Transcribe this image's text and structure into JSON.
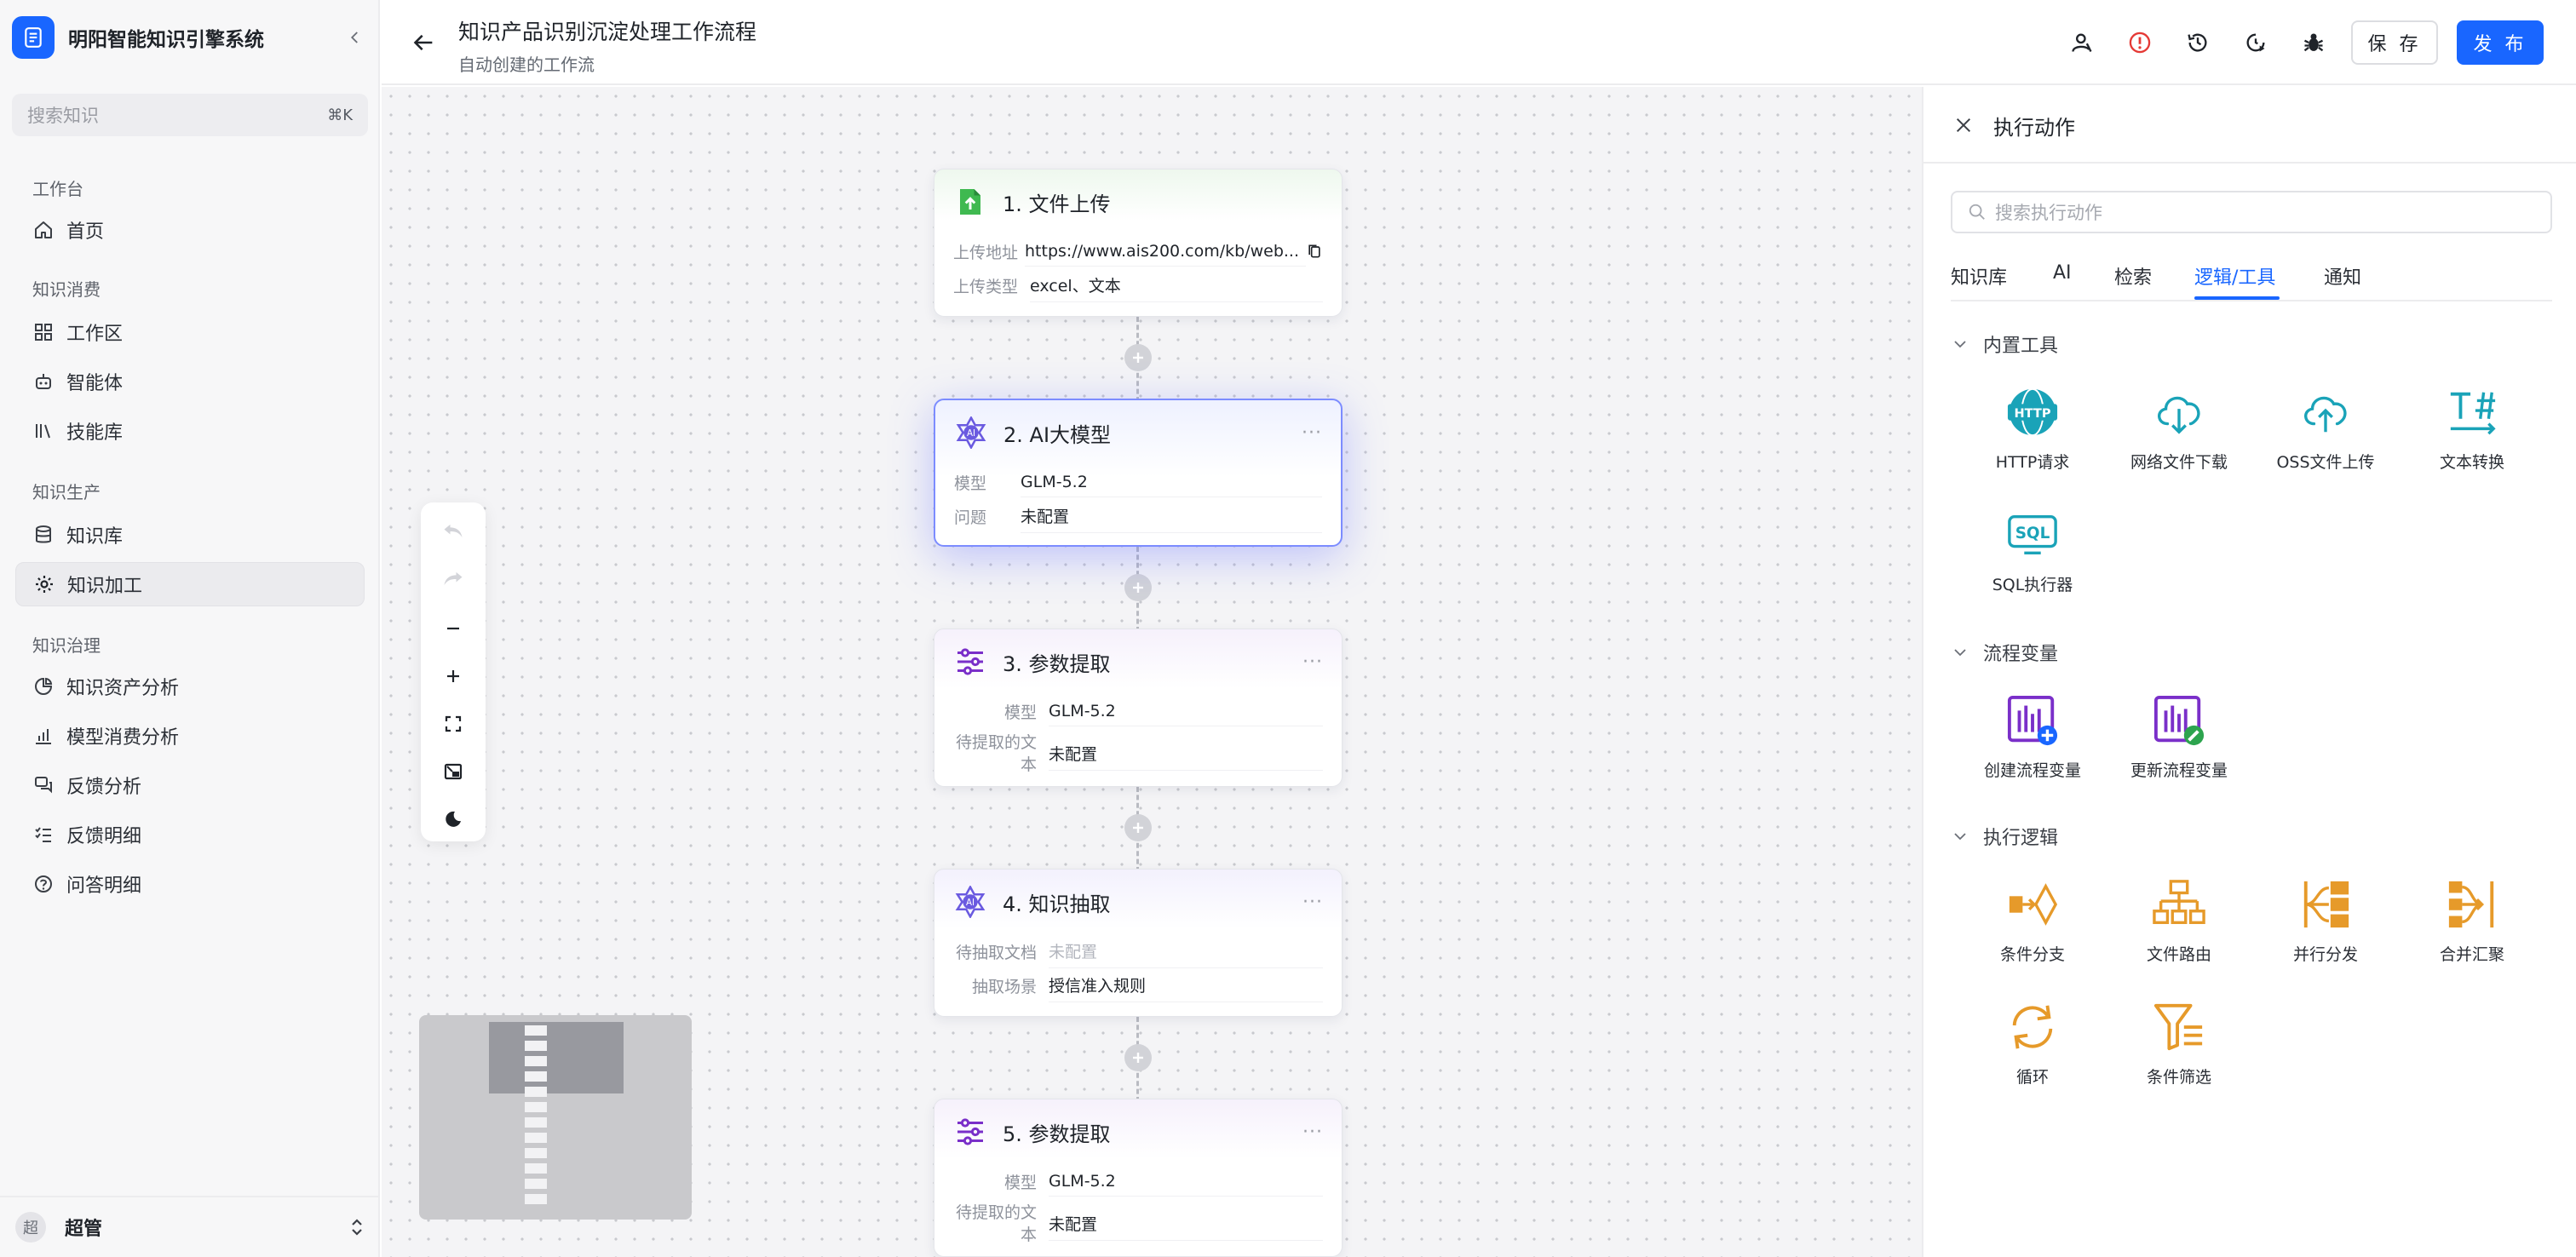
{
  "brand": {
    "name": "明阳智能知识引擎系统"
  },
  "sidebar": {
    "search_placeholder": "搜索知识",
    "search_shortcut": "⌘K",
    "groups": [
      "工作台",
      "知识消费",
      "知识生产",
      "知识治理"
    ],
    "items": [
      {
        "label": "首页"
      },
      {
        "label": "工作区"
      },
      {
        "label": "智能体"
      },
      {
        "label": "技能库"
      },
      {
        "label": "知识库"
      },
      {
        "label": "知识加工"
      },
      {
        "label": "知识资产分析"
      },
      {
        "label": "模型消费分析"
      },
      {
        "label": "反馈分析"
      },
      {
        "label": "反馈明细"
      },
      {
        "label": "问答明细"
      }
    ],
    "user": {
      "avatar": "超",
      "name": "超管"
    }
  },
  "topbar": {
    "title": "知识产品识别沉淀处理工作流程",
    "subtitle": "自动创建的工作流",
    "save_label": "保 存",
    "publish_label": "发 布"
  },
  "nodes": [
    {
      "title": "1. 文件上传",
      "rows": [
        {
          "k": "上传地址",
          "v": "https://www.ais200.com/kb/web..."
        },
        {
          "k": "上传类型",
          "v": "excel、文本"
        }
      ]
    },
    {
      "title": "2. AI大模型",
      "more": "···",
      "rows": [
        {
          "k": "模型",
          "v": "GLM-5.2"
        },
        {
          "k": "问题",
          "v": "未配置"
        }
      ]
    },
    {
      "title": "3. 参数提取",
      "more": "···",
      "rows": [
        {
          "k": "模型",
          "v": "GLM-5.2"
        },
        {
          "k": "待提取的文本",
          "v": "未配置"
        }
      ]
    },
    {
      "title": "4. 知识抽取",
      "more": "···",
      "rows": [
        {
          "k": "待抽取文档",
          "v": "未配置"
        },
        {
          "k": "抽取场景",
          "v": "授信准入规则"
        }
      ]
    },
    {
      "title": "5. 参数提取",
      "more": "···",
      "rows": [
        {
          "k": "模型",
          "v": "GLM-5.2"
        },
        {
          "k": "待提取的文本",
          "v": "未配置"
        }
      ]
    }
  ],
  "panel": {
    "title": "执行动作",
    "search_placeholder": "搜索执行动作",
    "tabs": [
      "知识库",
      "AI",
      "检索",
      "逻辑/工具",
      "通知"
    ],
    "active_tab": "逻辑/工具",
    "sections": [
      {
        "title": "内置工具",
        "tools": [
          "HTTP请求",
          "网络文件下载",
          "OSS文件上传",
          "文本转换",
          "SQL执行器"
        ]
      },
      {
        "title": "流程变量",
        "tools": [
          "创建流程变量",
          "更新流程变量"
        ]
      },
      {
        "title": "执行逻辑",
        "tools": [
          "条件分支",
          "文件路由",
          "并行分发",
          "合并汇聚",
          "循环",
          "条件筛选"
        ]
      }
    ]
  },
  "colors": {
    "accent": "#1966ff",
    "tool_teal": "#1aa3b8",
    "tool_orange": "#e69a2a",
    "variable_purple": "#7a2fc9",
    "upload_green": "#3fb950"
  }
}
